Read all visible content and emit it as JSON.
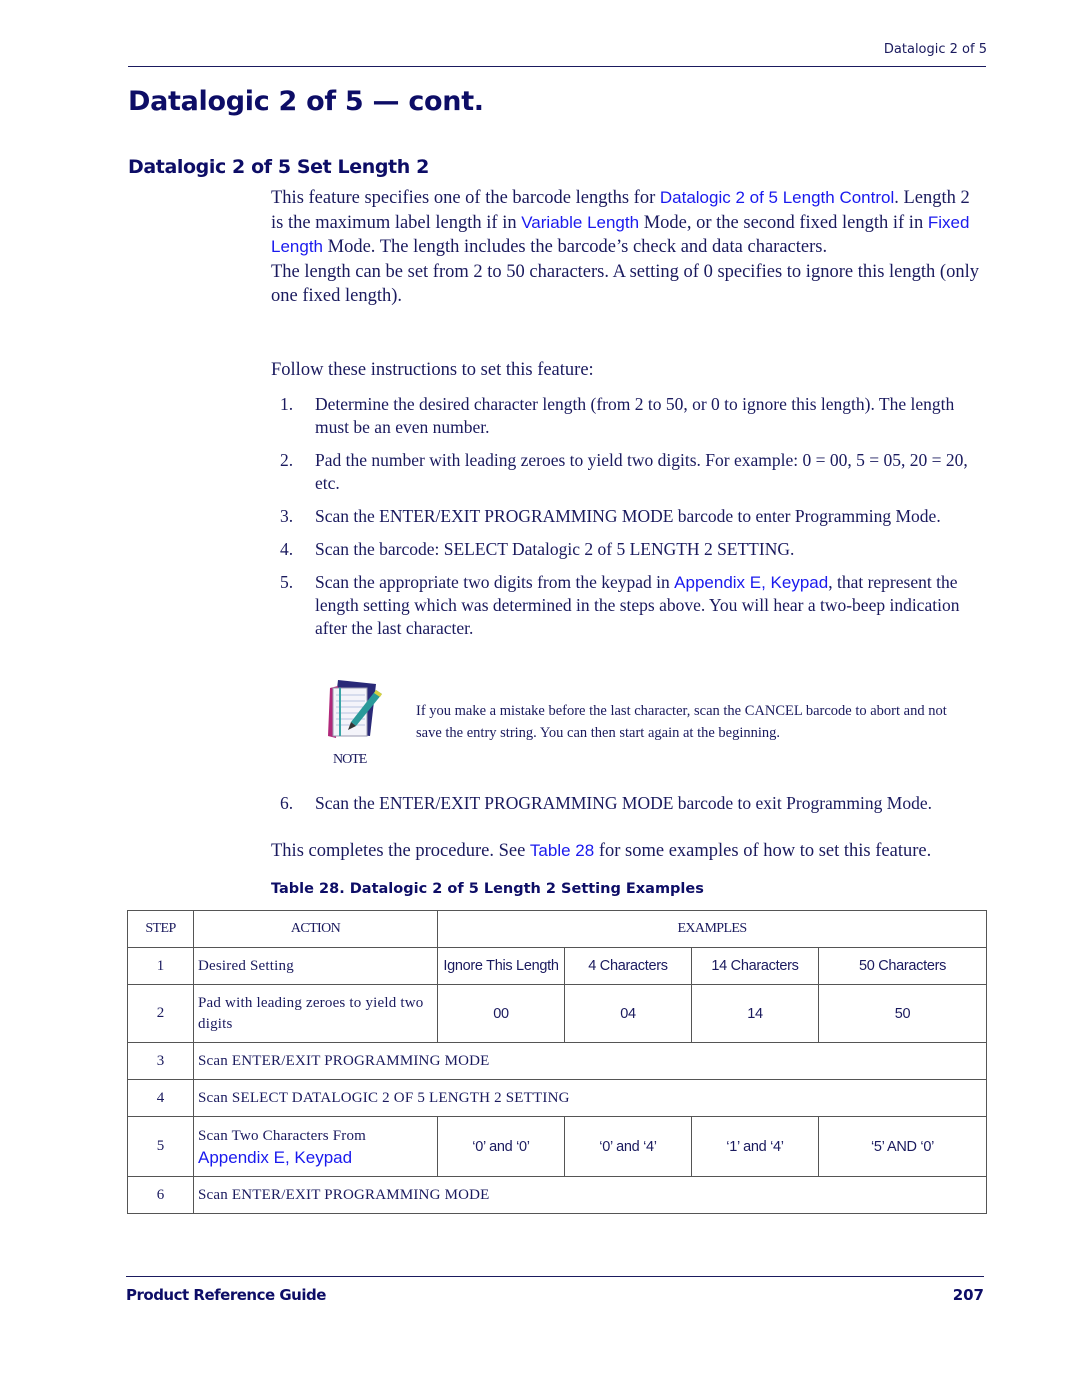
{
  "header": {
    "running_head": "Datalogic 2 of 5",
    "page_title": "Datalogic 2 of 5 — cont.",
    "section_title": "Datalogic 2 of 5 Set Length 2"
  },
  "intro": {
    "p1_a": "This feature specifies one of the barcode lengths for ",
    "p1_link1": "Datalogic 2 of 5 Length Control",
    "p1_b": ". Length 2 is the maximum label length if in ",
    "p1_link2": "Variable Length",
    "p1_c": " Mode, or the second fixed length if in ",
    "p1_link3": "Fixed Length",
    "p1_d": " Mode. The length includes the barcode’s check and data characters.",
    "p2": "The length can be set from 2 to 50 characters. A setting of 0 specifies to ignore this length (only one fixed length).",
    "p3": "Follow these instructions to set this feature:"
  },
  "steps": [
    {
      "num": "1.",
      "text": "Determine the desired character length (from 2 to 50, or 0 to ignore this length). The length must be an even number."
    },
    {
      "num": "2.",
      "text": "Pad the number with leading zeroes to yield two digits. For example: 0 = 00, 5 = 05, 20 = 20, etc."
    },
    {
      "num": "3.",
      "text": "Scan the ENTER/EXIT PROGRAMMING MODE barcode to enter Programming Mode."
    },
    {
      "num": "4.",
      "text": "Scan the barcode: SELECT Datalogic 2 of 5 LENGTH 2 SETTING."
    },
    {
      "num": "5.",
      "text_a": "Scan the appropriate two digits from the keypad in ",
      "link": "Appendix E, Keypad",
      "text_b": ", that represent the length setting which was determined in the steps above. You will hear a two-beep indication after the last character."
    },
    {
      "num": "6.",
      "text": "Scan the ENTER/EXIT PROGRAMMING MODE barcode to exit Programming Mode."
    }
  ],
  "note": {
    "label": "NOTE",
    "icon": "note-pad-pen-icon",
    "text": "If you make a mistake before the last character, scan the CANCEL barcode to abort and not save the entry string. You can then start again at the beginning."
  },
  "closing": {
    "a": "This completes the procedure. See ",
    "link": "Table 28",
    "b": " for some examples of how to set this feature."
  },
  "table": {
    "caption": "Table 28. Datalogic 2 of 5 Length 2 Setting Examples",
    "headers": {
      "step": "STEP",
      "action": "ACTION",
      "examples": "EXAMPLES"
    },
    "rows": [
      {
        "step": "1",
        "action": "Desired Setting",
        "values": [
          "Ignore This Length",
          "4 Characters",
          "14 Characters",
          "50 Characters"
        ]
      },
      {
        "step": "2",
        "action": "Pad with leading zeroes to yield two digits",
        "values": [
          "00",
          "04",
          "14",
          "50"
        ]
      },
      {
        "step": "3",
        "action": "Scan ENTER/EXIT PROGRAMMING MODE"
      },
      {
        "step": "4",
        "action": "Scan SELECT DATALOGIC 2 OF 5 LENGTH 2 SETTING"
      },
      {
        "step": "5",
        "action": "Scan Two Characters From",
        "action_link": "Appendix E, Keypad",
        "values": [
          "‘0’ and ‘0’",
          "‘0’ and ‘4’",
          "‘1’ and ‘4’",
          "‘5’ AND ‘0’"
        ]
      },
      {
        "step": "6",
        "action": "Scan ENTER/EXIT PROGRAMMING MODE"
      }
    ]
  },
  "footer": {
    "guide_title": "Product Reference Guide",
    "page_number": "207"
  },
  "colors": {
    "text": "#1a1a5e",
    "heading": "#0d0d66",
    "link": "#1a1aee",
    "rule": "#1a1a5e"
  }
}
